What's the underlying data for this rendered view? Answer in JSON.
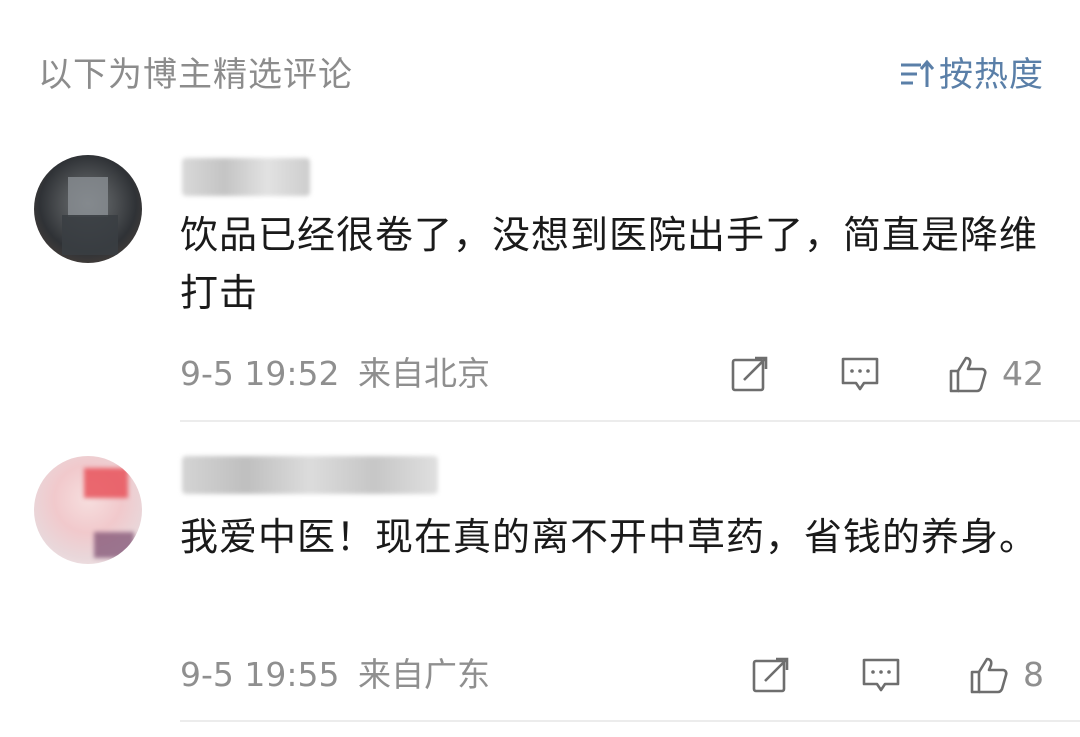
{
  "header": {
    "title": "以下为博主精选评论",
    "sort_icon": "sort-icon",
    "sort_label": "按热度",
    "accent_color": "#5a7fa8"
  },
  "comments": [
    {
      "text": "饮品已经很卷了，没想到医院出手了，简直是降维打击",
      "time": "9-5 19:52",
      "location": "来自北京",
      "likes": "42"
    },
    {
      "text": "我爱中医！现在真的离不开中草药，省钱的养身。",
      "time": "9-5 19:55",
      "location": "来自广东",
      "likes": "8"
    }
  ],
  "colors": {
    "meta_text": "#8f8f8f",
    "icon_stroke": "#6e6e6e",
    "divider": "#ececec"
  }
}
